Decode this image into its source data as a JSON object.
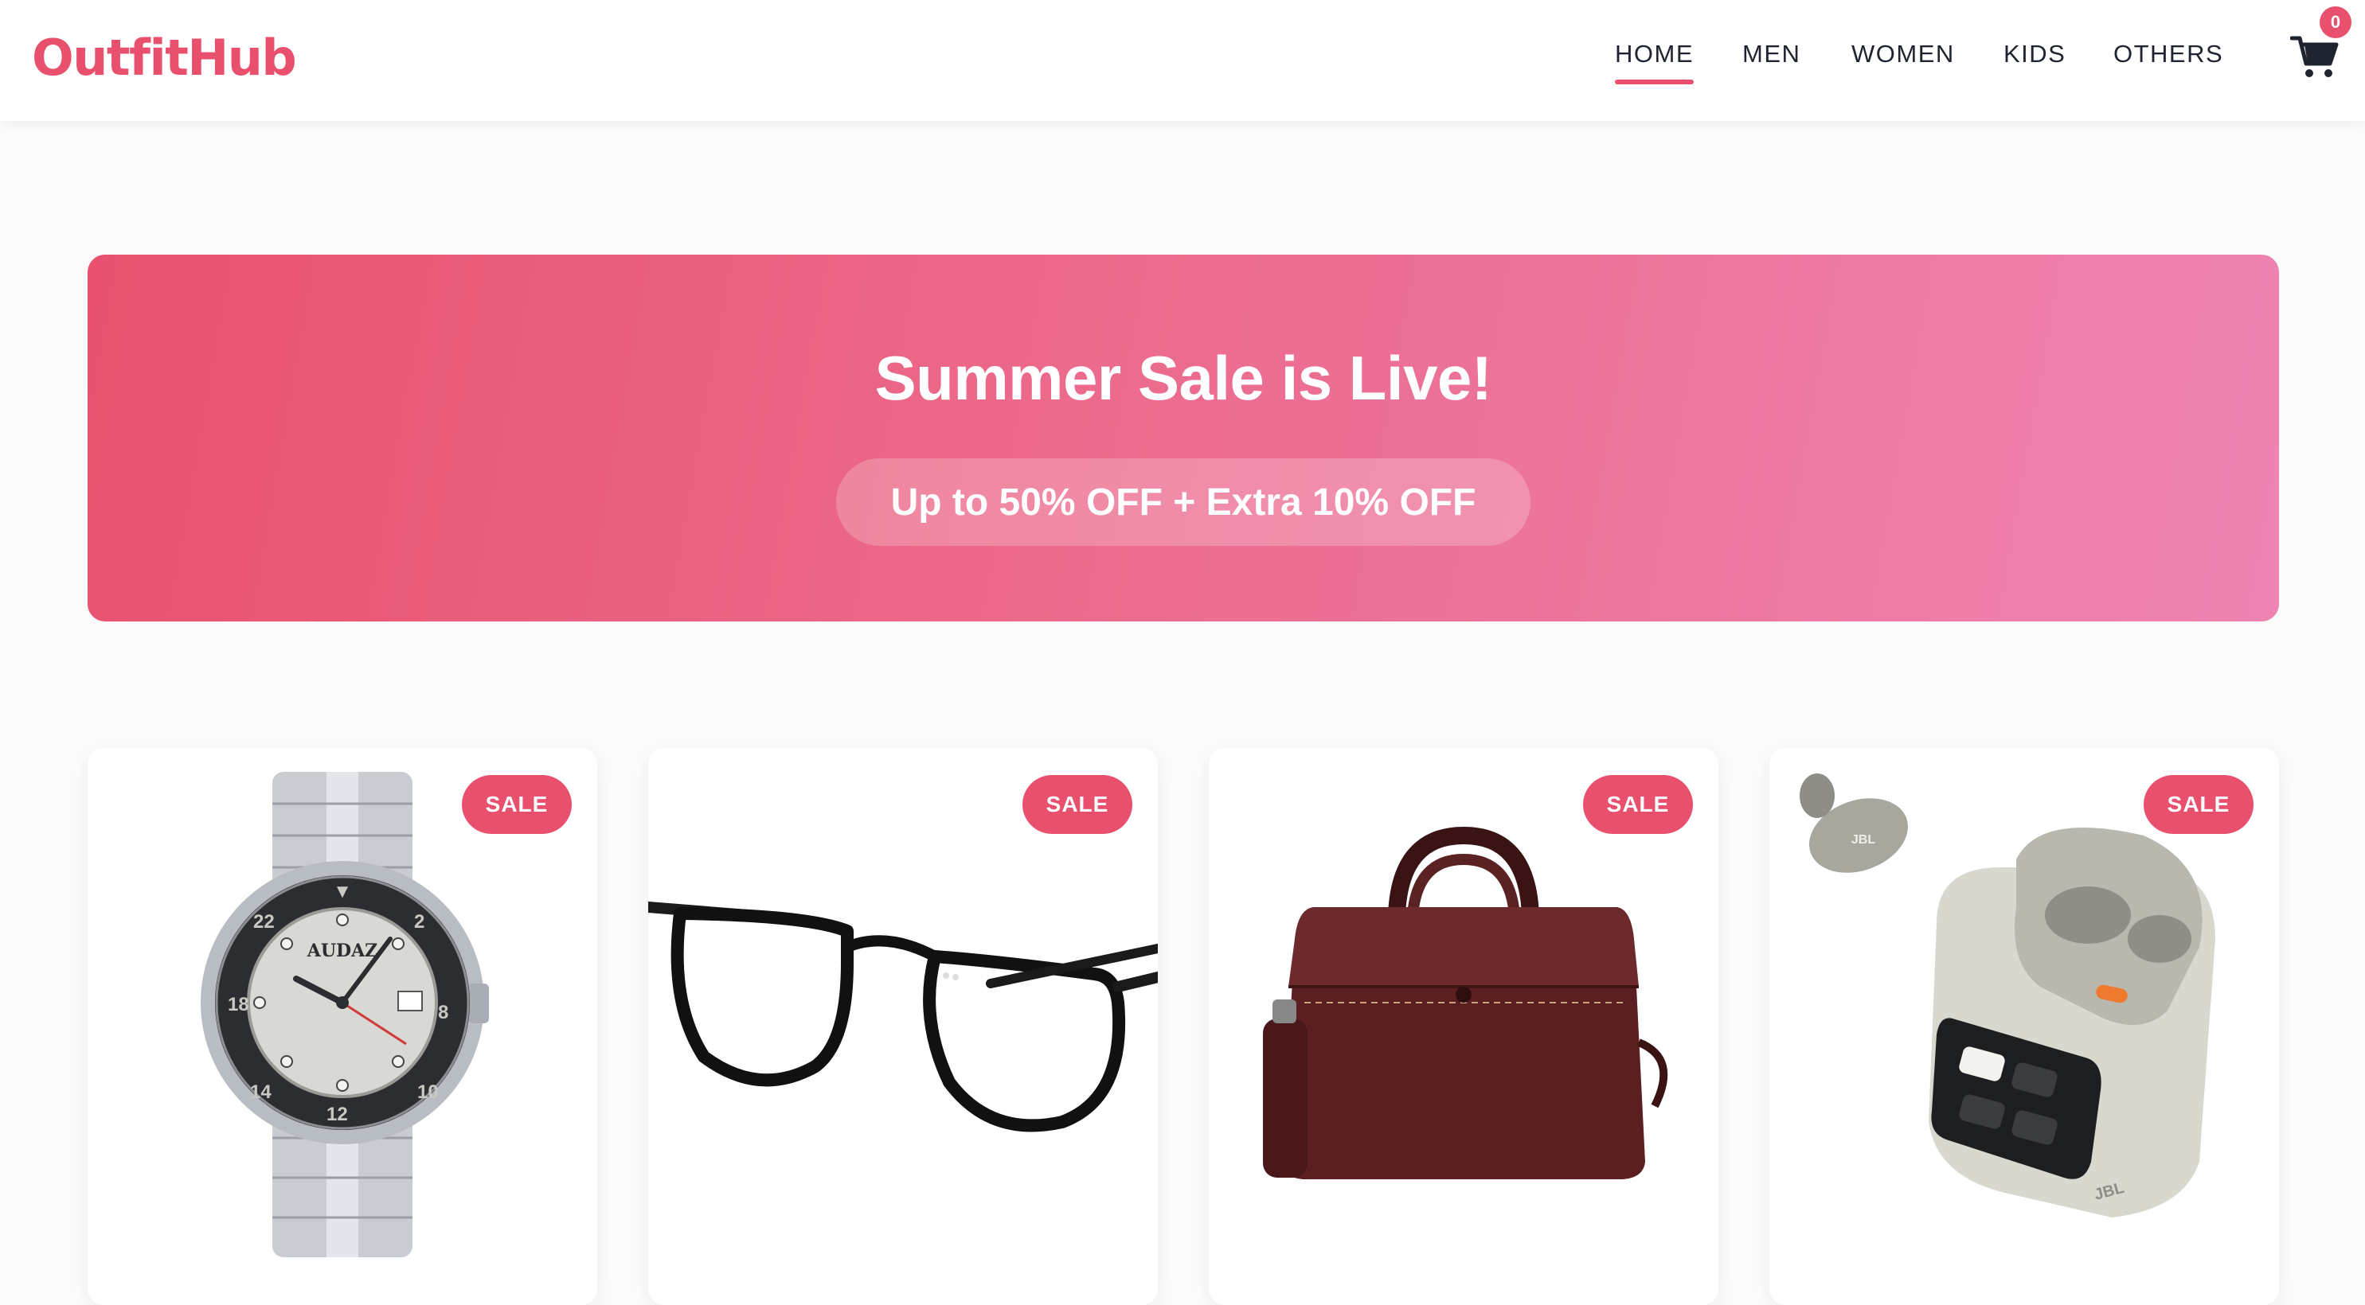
{
  "brand": {
    "name": "OutfitHub",
    "accent": "#e8506e"
  },
  "nav": {
    "items": [
      {
        "label": "HOME",
        "active": true
      },
      {
        "label": "MEN",
        "active": false
      },
      {
        "label": "WOMEN",
        "active": false
      },
      {
        "label": "KIDS",
        "active": false
      },
      {
        "label": "OTHERS",
        "active": false
      }
    ],
    "cart": {
      "icon": "cart-icon",
      "count": "0"
    }
  },
  "banner": {
    "title": "Summer Sale is Live!",
    "offer": "Up to 50% OFF + Extra 10% OFF",
    "gradient_colors": [
      "#e8526f",
      "#ee84b2"
    ]
  },
  "products": [
    {
      "badge": "SALE",
      "image": "wristwatch-image",
      "image_text": "AUDAZ"
    },
    {
      "badge": "SALE",
      "image": "eyeglasses-image"
    },
    {
      "badge": "SALE",
      "image": "leather-laptop-bag-image"
    },
    {
      "badge": "SALE",
      "image": "wireless-earbuds-case-image",
      "image_text": "JBL"
    }
  ]
}
